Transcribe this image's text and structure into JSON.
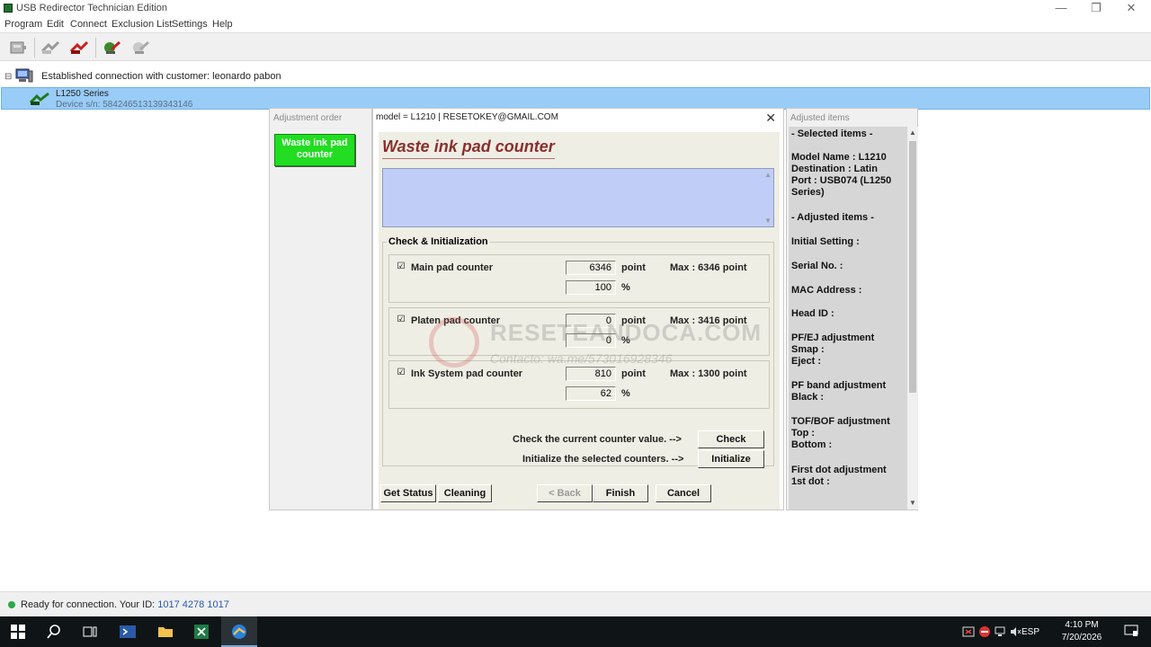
{
  "window": {
    "title": "USB Redirector Technician Edition",
    "controls": {
      "minimize": "—",
      "maximize": "❐",
      "close": "✕"
    }
  },
  "menu": [
    "Program",
    "Edit",
    "Connect",
    "Exclusion List",
    "Settings",
    "Help"
  ],
  "toolbar": [
    "device-icon",
    "share-icon",
    "connect-red-icon",
    "plugin-icon",
    "disconnect-icon"
  ],
  "tree": {
    "expander": "⊟",
    "connection_label": "Established connection with customer: leonardo pabon",
    "device_name": "L1250 Series",
    "device_sn": "Device s/n: 584246513139343146"
  },
  "adjustment_order": {
    "header": "Adjustment order",
    "item": "Waste ink pad counter"
  },
  "dialog": {
    "title": "model = L1210 | RESETOKEY@GMAIL.COM",
    "close": "✕",
    "heading": "Waste ink pad counter",
    "group_label": "Check & Initialization",
    "counters": [
      {
        "name": "Main pad counter",
        "checked": true,
        "points": "6346",
        "unit_point": "point",
        "percent": "100",
        "unit_pct": "%",
        "max": "Max : 6346 point"
      },
      {
        "name": "Platen pad counter",
        "checked": true,
        "points": "0",
        "unit_point": "point",
        "percent": "0",
        "unit_pct": "%",
        "max": "Max : 3416 point"
      },
      {
        "name": "Ink System pad counter",
        "checked": true,
        "points": "810",
        "unit_point": "point",
        "percent": "62",
        "unit_pct": "%",
        "max": "Max : 1300 point"
      }
    ],
    "check_label": "Check the current counter value. -->",
    "check_button": "Check",
    "init_label": "Initialize the selected counters. -->",
    "init_button": "Initialize",
    "buttons": {
      "get_status": "Get Status",
      "cleaning": "Cleaning",
      "back": "< Back",
      "finish": "Finish",
      "cancel": "Cancel"
    },
    "watermark": {
      "line1": "RESETEANDOCA.COM",
      "line2": "Contacto: wa.me/573016928346"
    }
  },
  "adjusted_items": {
    "header": "Adjusted items",
    "items": [
      "- Selected items -",
      "Model Name : L1210\nDestination : Latin\nPort : USB074 (L1250\nSeries)",
      "- Adjusted items -",
      "Initial Setting :",
      "Serial No. :",
      "MAC Address :",
      "Head ID :",
      "PF/EJ adjustment\n Smap :\n Eject :",
      "PF band adjustment\n Black :",
      "TOF/BOF adjustment\n Top :\n Bottom :",
      "First dot adjustment\n 1st dot :"
    ]
  },
  "status": {
    "text": "Ready for connection. Your ID:",
    "id": "1017 4278 1017"
  },
  "taskbar": {
    "lang": "ESP",
    "time": "4:10 PM",
    "date": "7/20/2026"
  }
}
